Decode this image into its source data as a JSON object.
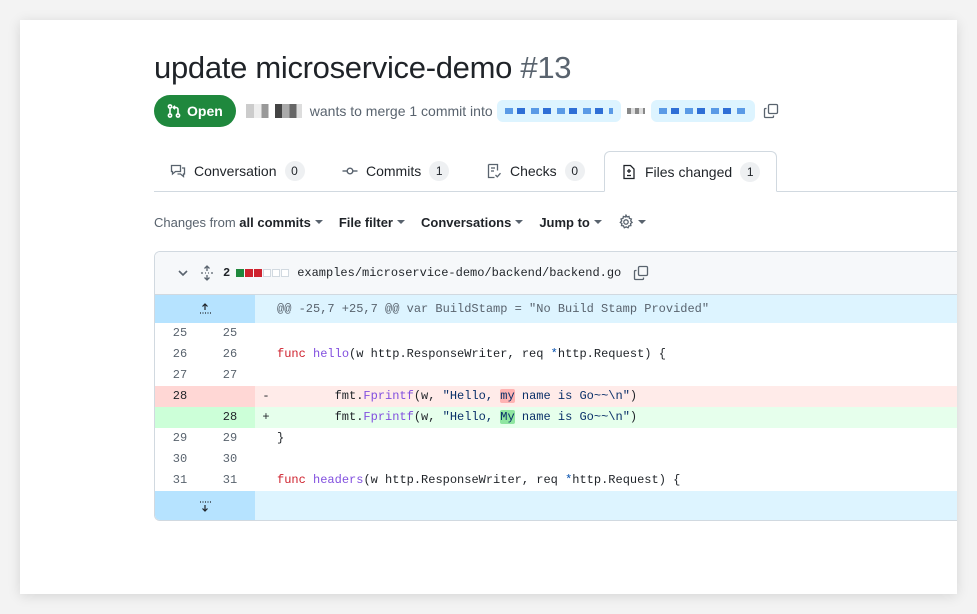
{
  "pr": {
    "title": "update microservice-demo",
    "number": "#13",
    "status": "Open",
    "merge_text": "wants to merge 1 commit into"
  },
  "tabs": [
    {
      "label": "Conversation",
      "count": "0",
      "icon": "comment-icon"
    },
    {
      "label": "Commits",
      "count": "1",
      "icon": "commit-icon"
    },
    {
      "label": "Checks",
      "count": "0",
      "icon": "checklist-icon"
    },
    {
      "label": "Files changed",
      "count": "1",
      "icon": "file-diff-icon",
      "active": true
    }
  ],
  "toolbar": {
    "changes_prefix": "Changes from",
    "changes_value": "all commits",
    "file_filter": "File filter",
    "conversations": "Conversations",
    "jump_to": "Jump to"
  },
  "file": {
    "changes_count": "2",
    "path": "examples/microservice-demo/backend/backend.go",
    "diffstat": [
      "add",
      "del",
      "del",
      "neutral",
      "neutral",
      "neutral"
    ]
  },
  "diff": {
    "hunk_header": "@@ -25,7 +25,7 @@ var BuildStamp = \"No Build Stamp Provided\"",
    "lines": [
      {
        "old": "25",
        "new": "25",
        "type": "ctx",
        "sign": "",
        "code": ""
      },
      {
        "old": "26",
        "new": "26",
        "type": "ctx",
        "sign": "",
        "code": "func hello(w http.ResponseWriter, req *http.Request) {"
      },
      {
        "old": "27",
        "new": "27",
        "type": "ctx",
        "sign": "",
        "code": ""
      },
      {
        "old": "28",
        "new": "",
        "type": "del",
        "sign": "-",
        "code": "        fmt.Fprintf(w, \"Hello, my name is Go~~\\n\")"
      },
      {
        "old": "",
        "new": "28",
        "type": "add",
        "sign": "+",
        "code": "        fmt.Fprintf(w, \"Hello, My name is Go~~\\n\")"
      },
      {
        "old": "29",
        "new": "29",
        "type": "ctx",
        "sign": "",
        "code": "}"
      },
      {
        "old": "30",
        "new": "30",
        "type": "ctx",
        "sign": "",
        "code": ""
      },
      {
        "old": "31",
        "new": "31",
        "type": "ctx",
        "sign": "",
        "code": "func headers(w http.ResponseWriter, req *http.Request) {"
      }
    ]
  },
  "colors": {
    "open_badge": "#1f883d",
    "del_bg": "#ffebe9",
    "add_bg": "#e6ffec",
    "hunk_bg": "#ddf4ff"
  }
}
